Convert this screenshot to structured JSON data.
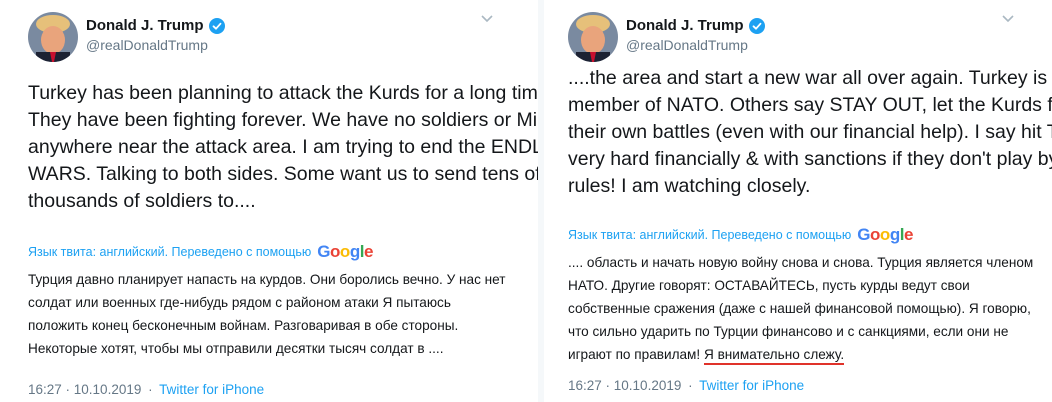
{
  "tweets": [
    {
      "author": {
        "name": "Donald J. Trump",
        "handle": "@realDonaldTrump",
        "verified": true
      },
      "lines": [
        "Turkey has been planning to attack the Kurds for a long time.",
        "They have been fighting forever. We have no soldiers or Military",
        "anywhere near the attack area. I am trying to end the ENDLESS",
        "WARS. Talking to both sides. Some want us to send tens of",
        "thousands of soldiers to...."
      ],
      "translation_label": "Язык твита: английский. Переведено с помощью",
      "translated_lines": [
        "Турция давно планирует напасть на курдов. Они боролись вечно. У нас нет",
        "солдат или военных где-нибудь рядом с районом атаки Я пытаюсь",
        "положить конец бесконечным войнам. Разговаривая в обе стороны.",
        "Некоторые хотят, чтобы мы отправили десятки тысяч солдат в ...."
      ],
      "time": "16:27 · 10.10.2019",
      "separator": "·",
      "source": "Twitter for iPhone"
    },
    {
      "author": {
        "name": "Donald J. Trump",
        "handle": "@realDonaldTrump",
        "verified": true
      },
      "lines": [
        "....the area and start a new war all over again. Turkey is a",
        "member of NATO. Others say STAY OUT, let the Kurds fight",
        "their own battles (even with our financial help). I say hit Turkey",
        "very hard financially & with sanctions if they don't play by the",
        "rules! I am watching closely."
      ],
      "translation_label": "Язык твита: английский. Переведено с помощью",
      "translated_lines": [
        ".... область и начать новую войну снова и снова. Турция является членом",
        "НАТО. Другие говорят: ОСТАВАЙТЕСЬ, пусть курды ведут свои",
        "собственные сражения (даже с нашей финансовой помощью). Я говорю,",
        "что сильно ударить по Турции финансово и с санкциями, если они не"
      ],
      "translated_last_prefix": "играют по правилам! ",
      "translated_last_highlight": "Я внимательно слежу.",
      "time": "16:27 · 10.10.2019",
      "separator": "·",
      "source": "Twitter for iPhone"
    }
  ],
  "google_letters": [
    "G",
    "o",
    "o",
    "g",
    "l",
    "e"
  ],
  "colors": {
    "link": "#1da1f2",
    "muted": "#657786",
    "text": "#14171a",
    "highlight_underline": "#e0322a"
  },
  "icons": {
    "verified": "verified-badge-icon",
    "caret": "chevron-down-icon",
    "avatar": "avatar-photo"
  }
}
